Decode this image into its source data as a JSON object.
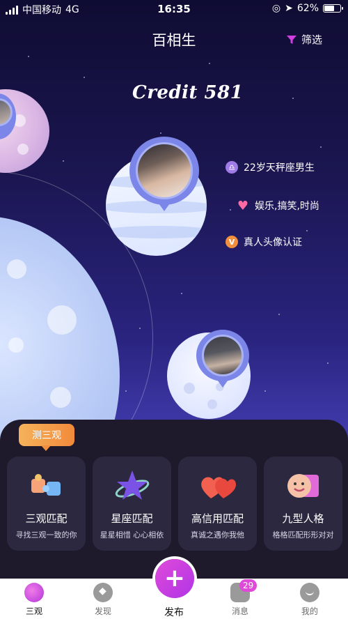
{
  "status_bar": {
    "carrier": "中国移动",
    "network": "4G",
    "time": "16:35",
    "battery": "62%",
    "battery_level": 0.62
  },
  "header": {
    "title": "百相生",
    "filter_label": "筛选"
  },
  "credit": "Credit 581",
  "profile_tags": [
    {
      "icon": "libra-icon",
      "text": "22岁天秤座男生",
      "color": "#9f7be8"
    },
    {
      "icon": "heart-icon",
      "text": "娱乐,搞笑,时尚",
      "color": "#ff5a9a"
    },
    {
      "icon": "verified-icon",
      "text": "真人头像认证",
      "color": "#f28f3e"
    }
  ],
  "test_badge": "测三观",
  "cards": [
    {
      "title": "三观匹配",
      "subtitle": "寻找三观一致的你",
      "icon": "puzzle-icon"
    },
    {
      "title": "星座匹配",
      "subtitle": "星星相惜 心心相依",
      "icon": "star-planet-icon"
    },
    {
      "title": "高信用匹配",
      "subtitle": "真诚之遇你我他",
      "icon": "hearts-icon"
    },
    {
      "title": "九型人格",
      "subtitle": "格格匹配形形对对",
      "icon": "face-card-icon"
    }
  ],
  "tabs": [
    {
      "label": "三观",
      "icon": "planet-icon"
    },
    {
      "label": "发现",
      "icon": "compass-icon"
    },
    {
      "label": "发布",
      "icon": "plus-icon"
    },
    {
      "label": "消息",
      "icon": "message-icon",
      "badge": "29"
    },
    {
      "label": "我的",
      "icon": "profile-icon"
    }
  ],
  "colors": {
    "accent": "#d23fe0",
    "panel": "#1e1a2c",
    "card": "#2c2840",
    "badge": "#f28f3e"
  }
}
